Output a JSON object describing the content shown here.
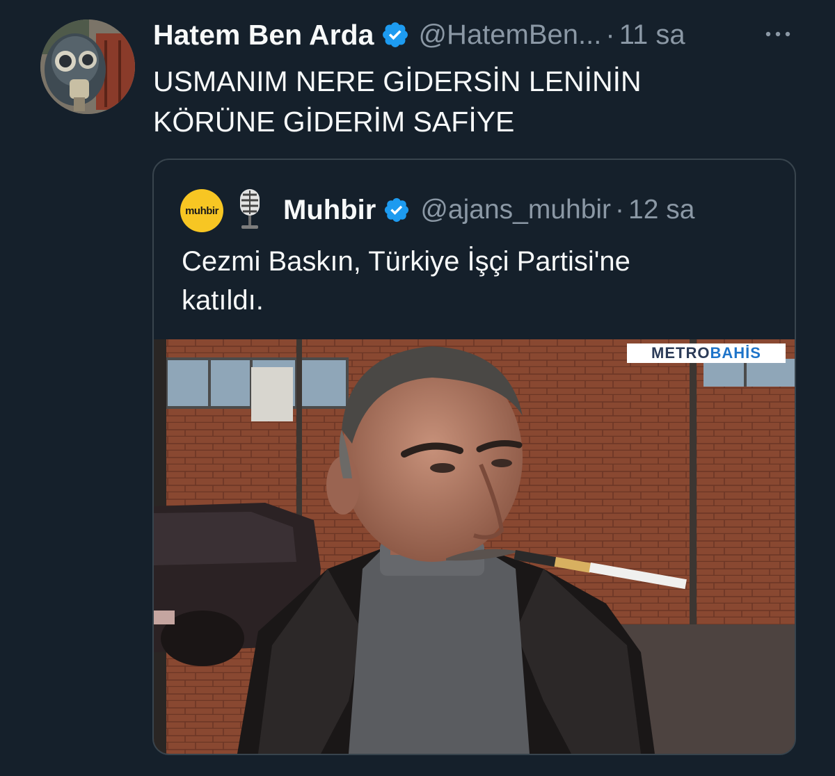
{
  "tweet": {
    "display_name": "Hatem Ben Arda",
    "handle": "@HatemBen...",
    "separator": "·",
    "time": "11 sa",
    "text_lines": [
      "USMANIM NERE GİDERSİN LENİNİN",
      "KÖRÜNE GİDERİM SAFİYE"
    ],
    "more_icon": "more-horizontal-icon"
  },
  "quote": {
    "avatar_text": "muhbir",
    "display_name": "Muhbir",
    "handle": "@ajans_muhbir",
    "separator": "·",
    "time": "12 sa",
    "text_lines": [
      "Cezmi Baskın, Türkiye İşçi Partisi'ne",
      "katıldı."
    ],
    "media": {
      "watermark_part1": "METRO",
      "watermark_part2": "BAHİS"
    }
  },
  "colors": {
    "background": "#15202b",
    "text": "#f7f9f9",
    "secondary_text": "#8b98a5",
    "border": "#38444d",
    "verified": "#1d9bf0"
  }
}
